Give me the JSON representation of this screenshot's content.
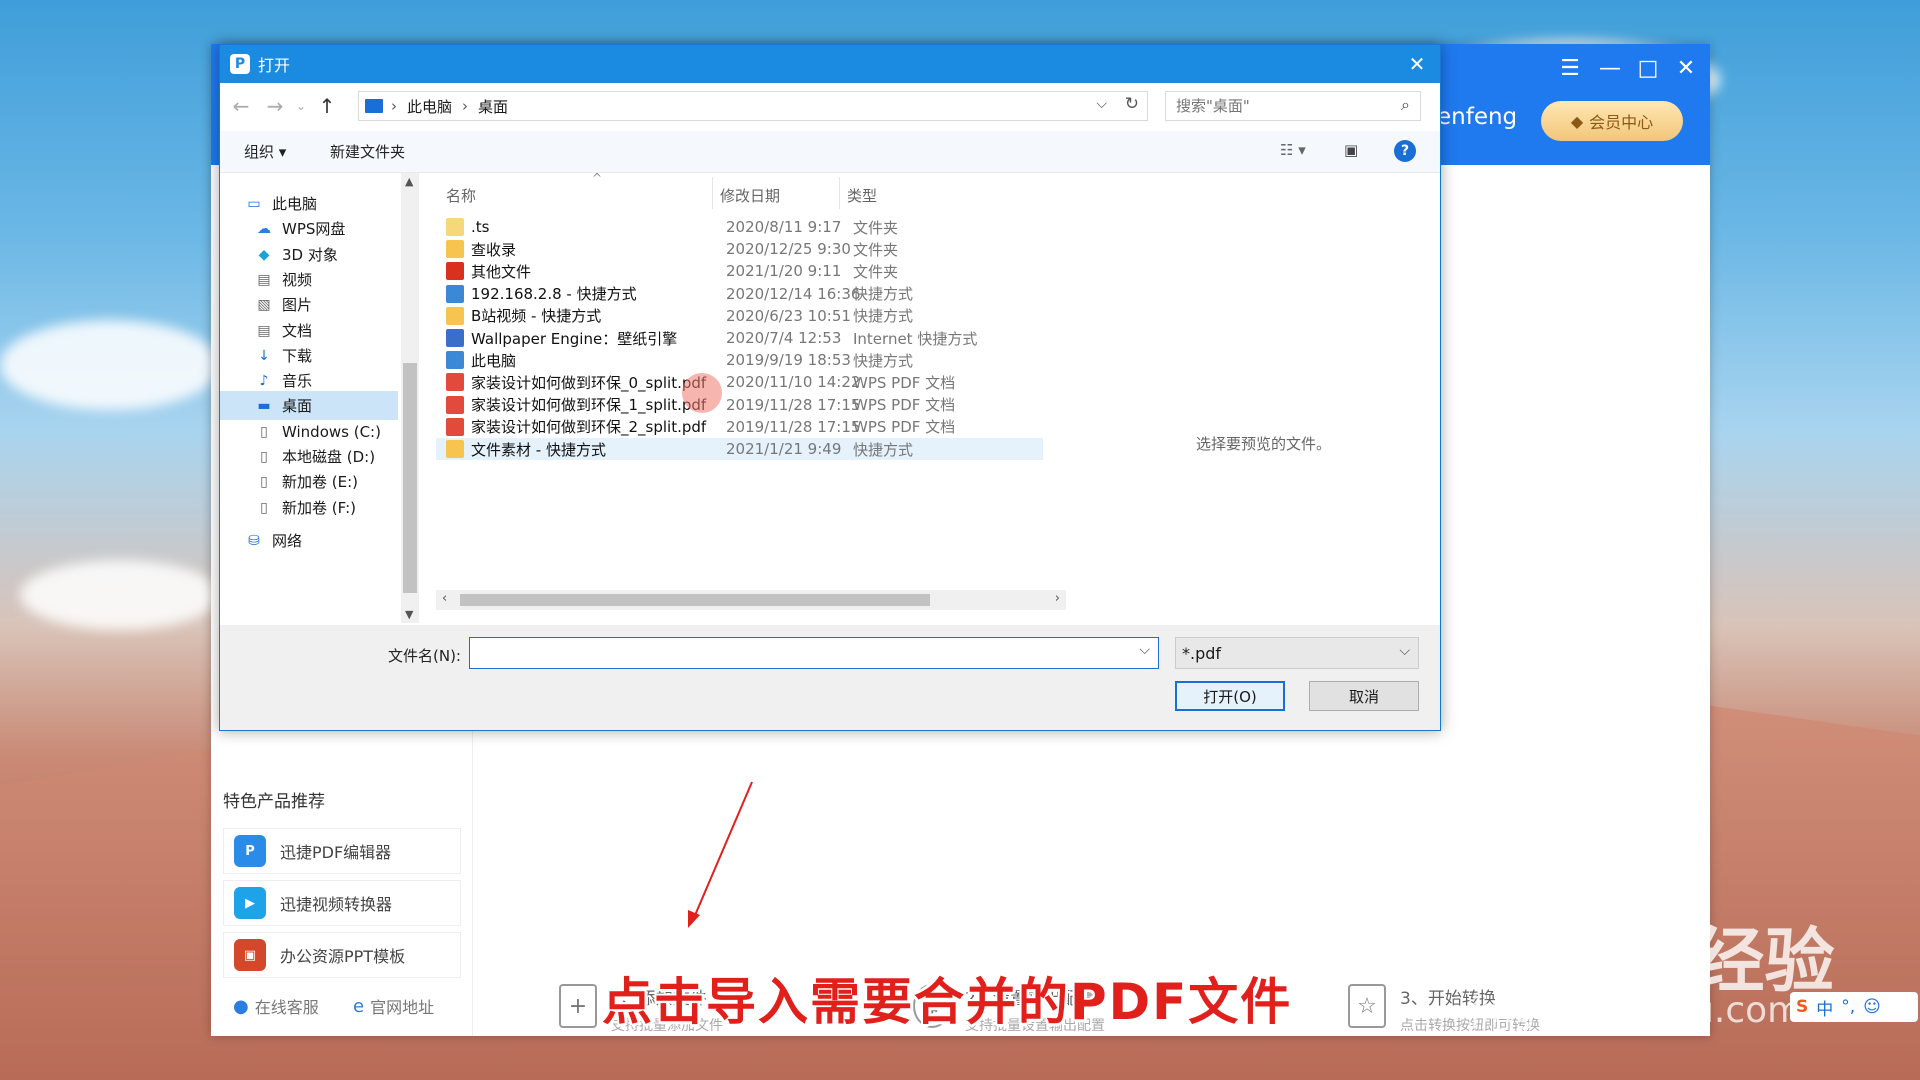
{
  "app": {
    "user_partial": "enfeng",
    "vip_label": "会员中心",
    "featured_title": "特色产品推荐",
    "products": [
      "迅捷PDF编辑器",
      "迅捷视频转换器",
      "办公资源PPT模板"
    ],
    "footer_links": [
      "在线客服",
      "官网地址"
    ],
    "steps": [
      {
        "title": "1、添加文件",
        "sub": "支持批量添加文件"
      },
      {
        "title": "2、设置输出配置",
        "sub": "支持批量设置输出配置"
      },
      {
        "title": "3、开始转换",
        "sub": "点击转换按钮即可转换"
      }
    ]
  },
  "dialog": {
    "title": "打开",
    "breadcrumb": [
      "此电脑",
      "桌面"
    ],
    "search_placeholder": "搜索\"桌面\"",
    "toolbar": {
      "organize": "组织",
      "new_folder": "新建文件夹"
    },
    "nav_items": [
      {
        "label": "此电脑",
        "icon": "computer-icon"
      },
      {
        "label": "WPS网盘",
        "icon": "cloud-icon"
      },
      {
        "label": "3D 对象",
        "icon": "cube-icon"
      },
      {
        "label": "视频",
        "icon": "video-icon"
      },
      {
        "label": "图片",
        "icon": "picture-icon"
      },
      {
        "label": "文档",
        "icon": "document-icon"
      },
      {
        "label": "下载",
        "icon": "download-icon"
      },
      {
        "label": "音乐",
        "icon": "music-icon"
      },
      {
        "label": "桌面",
        "icon": "desktop-icon",
        "selected": true
      },
      {
        "label": "Windows (C:)",
        "icon": "drive-icon"
      },
      {
        "label": "本地磁盘 (D:)",
        "icon": "drive-icon"
      },
      {
        "label": "新加卷 (E:)",
        "icon": "drive-icon"
      },
      {
        "label": "新加卷 (F:)",
        "icon": "drive-icon"
      },
      {
        "label": "网络",
        "icon": "network-icon"
      }
    ],
    "columns": [
      "名称",
      "修改日期",
      "类型"
    ],
    "files": [
      {
        "name": ".ts",
        "date": "2020/8/11 9:17",
        "type": "文件夹",
        "color": "#f6d77a"
      },
      {
        "name": "查收录",
        "date": "2020/12/25 9:30",
        "type": "文件夹",
        "color": "#f6c44f"
      },
      {
        "name": "其他文件",
        "date": "2021/1/20 9:11",
        "type": "文件夹",
        "color": "#d8321f"
      },
      {
        "name": "192.168.2.8 - 快捷方式",
        "date": "2020/12/14 16:36",
        "type": "快捷方式",
        "color": "#3a88d6"
      },
      {
        "name": "B站视频 - 快捷方式",
        "date": "2020/6/23 10:51",
        "type": "快捷方式",
        "color": "#f6c44f"
      },
      {
        "name": "Wallpaper Engine：壁纸引擎",
        "date": "2020/7/4 12:53",
        "type": "Internet 快捷方式",
        "color": "#3a6ec8"
      },
      {
        "name": "此电脑",
        "date": "2019/9/19 18:53",
        "type": "快捷方式",
        "color": "#3a88d6"
      },
      {
        "name": "家装设计如何做到环保_0_split.pdf",
        "date": "2020/11/10 14:22",
        "type": "WPS PDF 文档",
        "color": "#e24a3b"
      },
      {
        "name": "家装设计如何做到环保_1_split.pdf",
        "date": "2019/11/28 17:15",
        "type": "WPS PDF 文档",
        "color": "#e24a3b"
      },
      {
        "name": "家装设计如何做到环保_2_split.pdf",
        "date": "2019/11/28 17:15",
        "type": "WPS PDF 文档",
        "color": "#e24a3b"
      },
      {
        "name": "文件素材 - 快捷方式",
        "date": "2021/1/21 9:49",
        "type": "快捷方式",
        "color": "#f6c44f",
        "selected": true
      }
    ],
    "preview_text": "选择要预览的文件。",
    "filename_label": "文件名(N):",
    "filename_value": "",
    "filter_value": "*.pdf",
    "open_label": "打开(O)",
    "cancel_label": "取消"
  },
  "overlay": {
    "caption": "点击导入需要合并的PDF文件",
    "watermark": "Baidu经验",
    "watermark_url": "jingyan.baidu.com",
    "ime_text": "中"
  }
}
